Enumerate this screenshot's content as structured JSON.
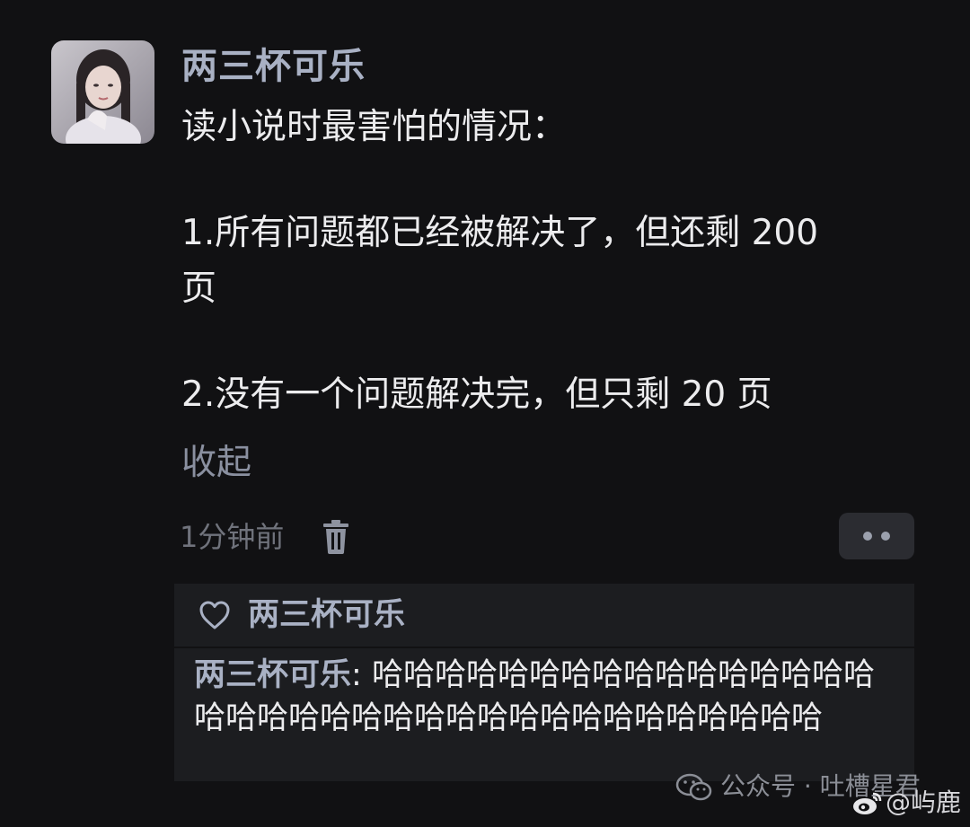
{
  "post": {
    "author": "两三杯可乐",
    "lines": [
      "读小说时最害怕的情况：",
      "1.所有问题都已经被解决了，但还剩 200",
      "页",
      "2.没有一个问题解决完，但只剩 20 页"
    ],
    "collapse_label": "收起",
    "timestamp": "1分钟前",
    "icons": {
      "delete": "trash-icon",
      "more": "more-dots-icon"
    }
  },
  "reply": {
    "like_icon": "heart-outline-icon",
    "liker": "两三杯可乐",
    "author": "两三杯可乐",
    "separator": ": ",
    "text": "哈哈哈哈哈哈哈哈哈哈哈哈哈哈哈哈哈哈哈哈哈哈哈哈哈哈哈哈哈哈哈哈哈哈哈哈"
  },
  "watermark": {
    "source": "公众号 · 吐槽星君",
    "weibo": "@屿鹿"
  },
  "colors": {
    "background": "#111113",
    "name": "#a9b1c4",
    "text": "#ececee",
    "muted": "#70737c",
    "reply_bg": "#1c1d20"
  }
}
